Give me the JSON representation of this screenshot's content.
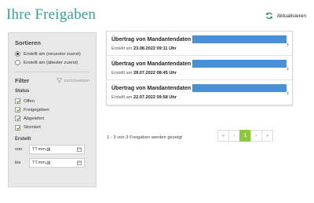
{
  "header": {
    "title": "Ihre Freigaben",
    "refresh_label": "Aktualisieren"
  },
  "sidebar": {
    "sort_heading": "Sortieren",
    "sort_options": [
      {
        "label": "Erstellt am (neuester zuerst)",
        "selected": true
      },
      {
        "label": "Erstellt am (ältester zuerst)",
        "selected": false
      }
    ],
    "filter_heading": "Filter",
    "reset_label": "zurücksetzen",
    "status_heading": "Status",
    "status_options": [
      {
        "label": "Offen",
        "checked": true
      },
      {
        "label": "Freigegeben",
        "checked": true
      },
      {
        "label": "Abgelehnt",
        "checked": true
      },
      {
        "label": "Storniert",
        "checked": true
      }
    ],
    "created_heading": "Erstellt",
    "from_label": "von",
    "to_label": "bis",
    "date_placeholder": "TT.mm.jjjj"
  },
  "list": {
    "items": [
      {
        "title": "Übertrag von Mandantendaten",
        "created_prefix": "Erstellt am",
        "created_value": "23.08.2022 09:11 Uhr"
      },
      {
        "title": "Übertrag von Mandantendaten",
        "created_prefix": "Erstellt am",
        "created_value": "28.07.2022 08:45 Uhr"
      },
      {
        "title": "Übertrag von Mandantendaten",
        "created_prefix": "Erstellt am",
        "created_value": "22.07.2022 09:58 Uhr"
      }
    ]
  },
  "pagination": {
    "summary": "1 - 3 von 3 Freigaben werden gezeigt",
    "first": "«",
    "prev": "‹",
    "current": "1",
    "next": "›",
    "last": "»"
  },
  "colors": {
    "accent_teal": "#3a9e96",
    "pager_active": "#8dc63f",
    "redaction": "#4a90d9"
  }
}
